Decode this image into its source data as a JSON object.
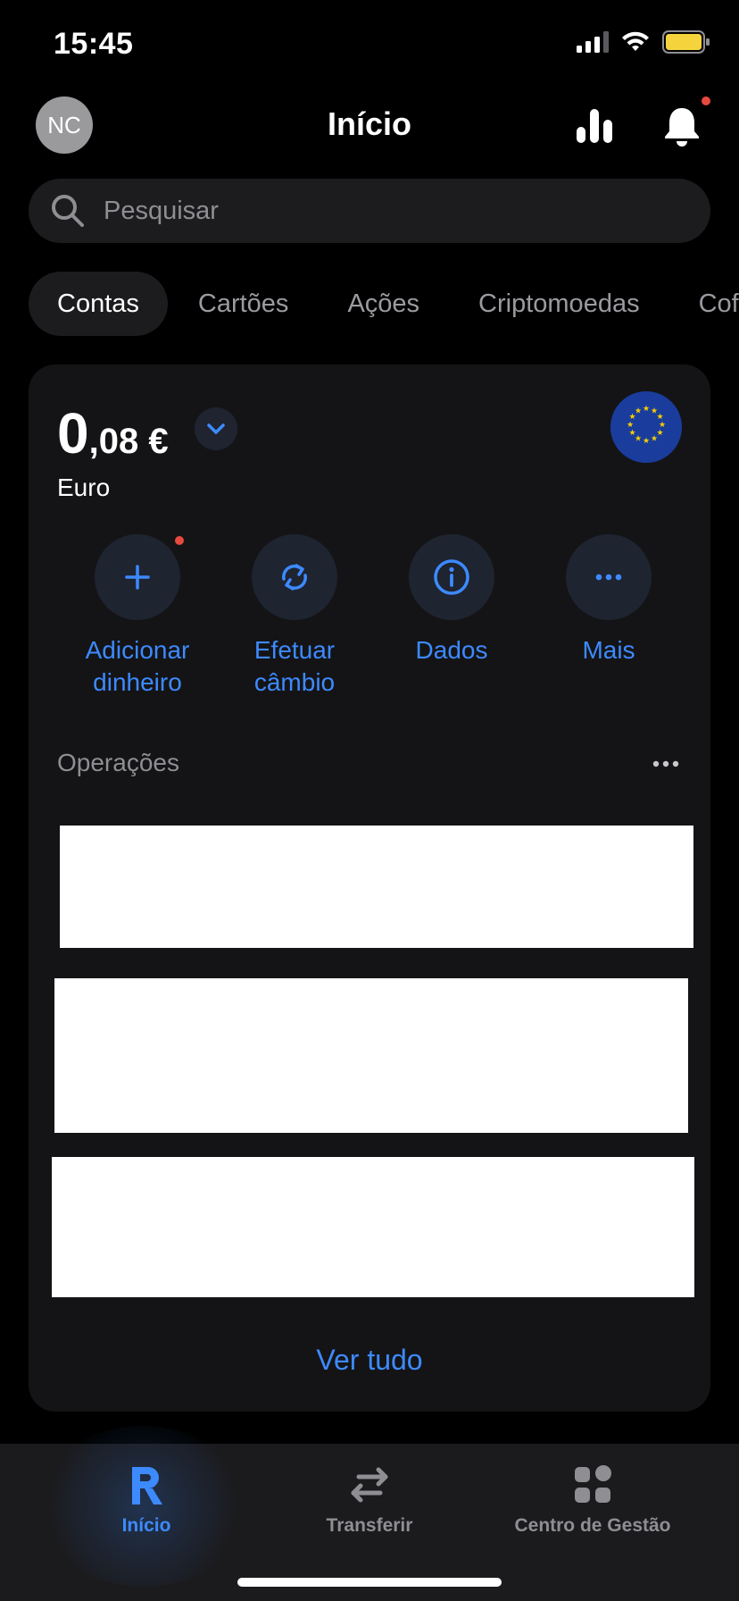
{
  "status_bar": {
    "time": "15:45"
  },
  "header": {
    "avatar_initials": "NC",
    "title": "Início"
  },
  "search": {
    "placeholder": "Pesquisar"
  },
  "tabs": [
    {
      "label": "Contas",
      "active": true
    },
    {
      "label": "Cartões",
      "active": false
    },
    {
      "label": "Ações",
      "active": false
    },
    {
      "label": "Criptomoedas",
      "active": false
    },
    {
      "label": "Cofres",
      "active": false
    }
  ],
  "account": {
    "balance_integer": "0",
    "balance_decimal": ",08 €",
    "currency_name": "Euro"
  },
  "actions": [
    {
      "line1": "Adicionar",
      "line2": "dinheiro"
    },
    {
      "line1": "Efetuar",
      "line2": "câmbio"
    },
    {
      "line1": "Dados",
      "line2": ""
    },
    {
      "line1": "Mais",
      "line2": ""
    }
  ],
  "operations": {
    "title": "Operações",
    "view_all": "Ver tudo"
  },
  "tabbar": [
    {
      "label": "Início",
      "icon": "revolut-r-icon",
      "active": true
    },
    {
      "label": "Transferir",
      "icon": "transfer-arrows-icon",
      "active": false
    },
    {
      "label": "Centro de Gestão",
      "icon": "hub-grid-icon",
      "active": false
    }
  ],
  "colors": {
    "accent": "#3d8aff",
    "card": "#141416",
    "notification": "#e8493f",
    "eu_blue": "#1a3c9c",
    "eu_star": "#f5d000"
  }
}
